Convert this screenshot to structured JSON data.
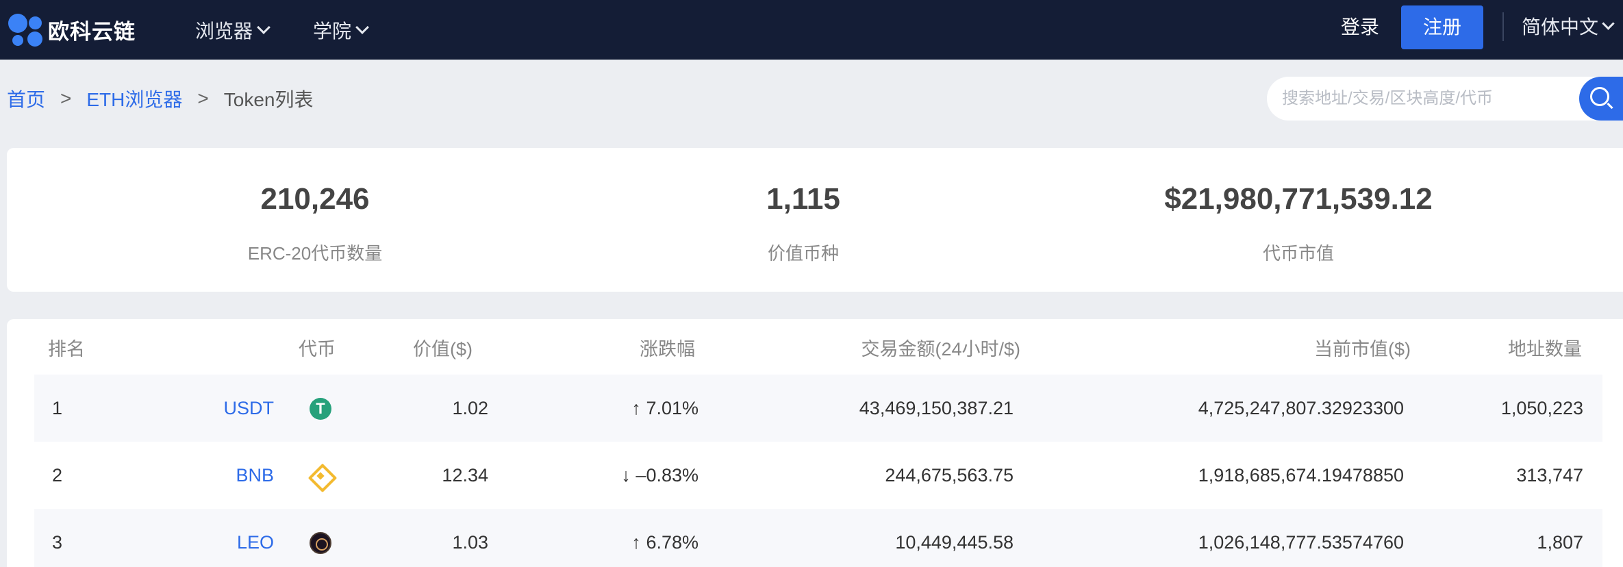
{
  "header": {
    "logo_text": "欧科云链",
    "nav": [
      {
        "label": "浏览器"
      },
      {
        "label": "学院"
      }
    ],
    "login_label": "登录",
    "register_label": "注册",
    "language_label": "简体中文"
  },
  "breadcrumb": {
    "home": "首页",
    "sep": ">",
    "explorer": "ETH浏览器",
    "current": "Token列表"
  },
  "search": {
    "placeholder": "搜索地址/交易/区块高度/代币"
  },
  "stats": [
    {
      "value": "210,246",
      "label": "ERC-20代币数量"
    },
    {
      "value": "1,115",
      "label": "价值币种"
    },
    {
      "value": "$21,980,771,539.12",
      "label": "代币市值"
    }
  ],
  "table": {
    "columns": [
      "排名",
      "代币",
      "价值($)",
      "涨跌幅",
      "交易金额(24小时/$)",
      "当前市值($)",
      "地址数量"
    ],
    "rows": [
      {
        "rank": "1",
        "token": "USDT",
        "coin_icon": "usdt-icon",
        "price": "1.02",
        "change": "7.01%",
        "change_dir": "up",
        "volume": "43,469,150,387.21",
        "market_cap": "4,725,247,807.32923300",
        "holders": "1,050,223"
      },
      {
        "rank": "2",
        "token": "BNB",
        "coin_icon": "bnb-icon",
        "price": "12.34",
        "change": "–0.83%",
        "change_dir": "down",
        "volume": "244,675,563.75",
        "market_cap": "1,918,685,674.19478850",
        "holders": "313,747"
      },
      {
        "rank": "3",
        "token": "LEO",
        "coin_icon": "leo-icon",
        "price": "1.03",
        "change": "6.78%",
        "change_dir": "up",
        "volume": "10,449,445.58",
        "market_cap": "1,026,148,777.53574760",
        "holders": "1,807"
      }
    ]
  },
  "colors": {
    "header_bg": "#141d36",
    "accent": "#2d6be8",
    "up": "#23a55a",
    "down": "#e84a4a",
    "page_bg": "#eceef2"
  }
}
